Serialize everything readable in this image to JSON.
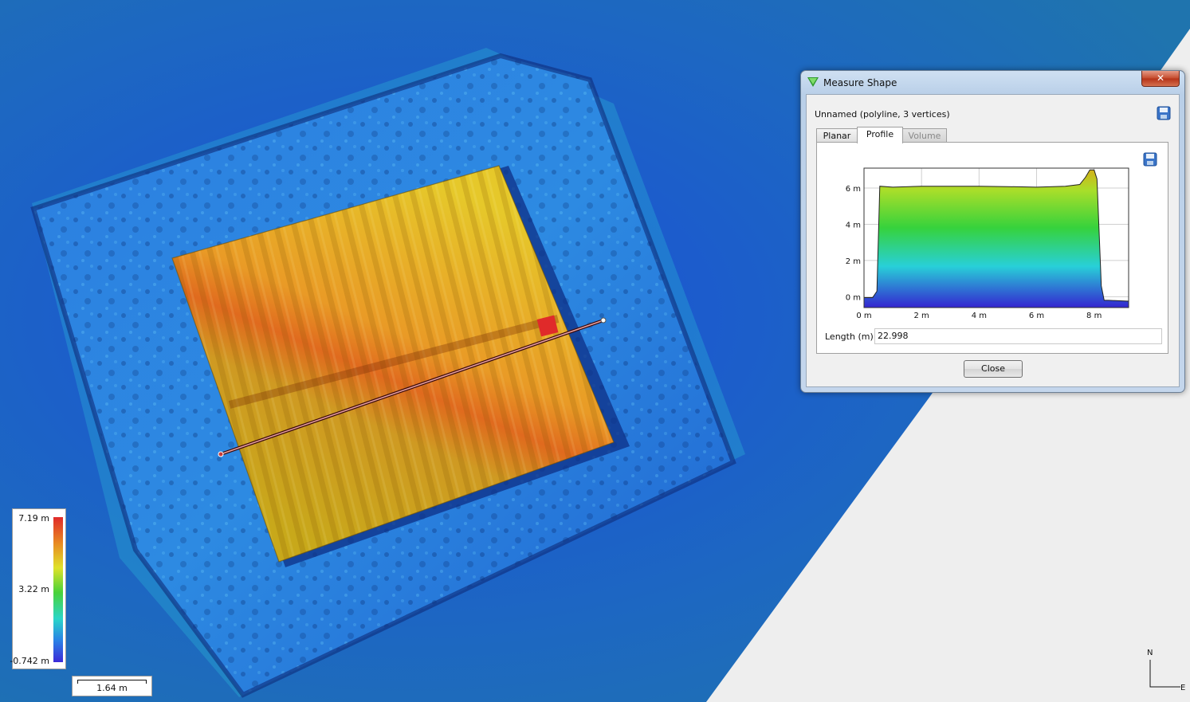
{
  "dialog": {
    "title": "Measure Shape",
    "shape_label": "Unnamed (polyline, 3 vertices)",
    "close_x": "✕",
    "tabs": [
      {
        "label": "Planar",
        "state": "normal"
      },
      {
        "label": "Profile",
        "state": "active"
      },
      {
        "label": "Volume",
        "state": "disabled"
      }
    ],
    "length_label": "Length (m):",
    "length_value": "22.998",
    "close_button": "Close"
  },
  "legend": {
    "max": "7.19 m",
    "mid": "3.22 m",
    "min": "-0.742 m"
  },
  "scale_bar": {
    "label": "1.64 m"
  },
  "compass": {
    "north": "N",
    "east": "E"
  },
  "chart_data": {
    "type": "area",
    "x_ticks": [
      "0 m",
      "2 m",
      "4 m",
      "6 m",
      "8 m"
    ],
    "y_ticks": [
      "0 m",
      "2 m",
      "4 m",
      "6 m"
    ],
    "xlim": [
      0,
      9.2
    ],
    "ylim": [
      -0.6,
      7.1
    ],
    "grid": true,
    "x": [
      0,
      0.3,
      0.45,
      0.55,
      1,
      2,
      3,
      4,
      5,
      6,
      7,
      7.5,
      7.7,
      7.85,
      8.0,
      8.1,
      8.25,
      8.35,
      8.5,
      9.2
    ],
    "y": [
      -0.05,
      -0.05,
      0.3,
      6.1,
      6.05,
      6.1,
      6.1,
      6.1,
      6.08,
      6.05,
      6.1,
      6.2,
      6.6,
      7.0,
      7.0,
      6.5,
      0.6,
      -0.2,
      -0.2,
      -0.25
    ],
    "colors": {
      "top": "#d4b21a",
      "upper": "#a8de2a",
      "mid": "#36d23c",
      "lower": "#28d0d8",
      "bottom": "#3425d0"
    }
  }
}
